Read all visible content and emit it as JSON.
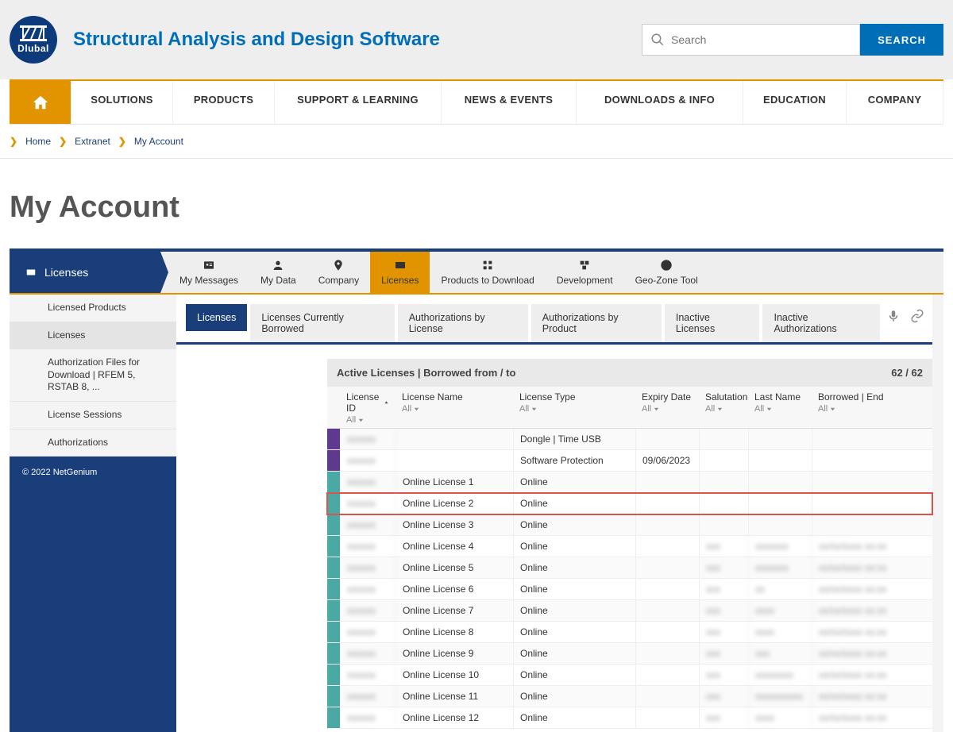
{
  "brand": {
    "logo_text": "Dlubal"
  },
  "site_title": "Structural Analysis and Design Software",
  "search": {
    "placeholder": "Search",
    "button": "SEARCH"
  },
  "main_nav": [
    "SOLUTIONS",
    "PRODUCTS",
    "SUPPORT & LEARNING",
    "NEWS & EVENTS",
    "DOWNLOADS & INFO",
    "EDUCATION",
    "COMPANY"
  ],
  "breadcrumb": [
    "Home",
    "Extranet",
    "My Account"
  ],
  "page_title": "My Account",
  "account_tabs": {
    "current": "Licenses",
    "items": [
      "My Messages",
      "My Data",
      "Company",
      "Licenses",
      "Products to Download",
      "Development",
      "Geo-Zone Tool"
    ],
    "active_index": 3
  },
  "sidenav": {
    "items": [
      "Licensed Products",
      "Licenses",
      "Authorization Files for Download | RFEM 5, RSTAB 8, ...",
      "License Sessions",
      "Authorizations"
    ],
    "active_index": 1
  },
  "sidebar_footer": "© 2022 NetGenium",
  "subtabs": {
    "items": [
      "Licenses",
      "Licenses Currently Borrowed",
      "Authorizations by License",
      "Authorizations by Product",
      "Inactive Licenses",
      "Inactive Authorizations"
    ],
    "active_index": 0
  },
  "table": {
    "title": "Active Licenses | Borrowed from / to",
    "count": "62 / 62",
    "filter_label": "All",
    "columns": [
      "License ID",
      "License Name",
      "License Type",
      "Expiry Date",
      "Salutation",
      "Last Name",
      "Borrowed | End"
    ],
    "rows": [
      {
        "marker": "purple",
        "id": "xxxxxx",
        "name": "",
        "type": "Dongle | Time USB",
        "expiry": "",
        "sal": "",
        "last": "",
        "borrow": ""
      },
      {
        "marker": "purple",
        "id": "xxxxxx",
        "name": "",
        "type": "Software Protection",
        "expiry": "09/06/2023",
        "sal": "",
        "last": "",
        "borrow": ""
      },
      {
        "marker": "teal",
        "id": "xxxxxx",
        "name": "Online License 1",
        "type": "Online",
        "expiry": "",
        "sal": "",
        "last": "",
        "borrow": ""
      },
      {
        "marker": "teal",
        "id": "xxxxxx",
        "name": "Online License 2",
        "type": "Online",
        "expiry": "",
        "sal": "",
        "last": "",
        "borrow": "",
        "highlight": true
      },
      {
        "marker": "teal",
        "id": "xxxxxx",
        "name": "Online License 3",
        "type": "Online",
        "expiry": "",
        "sal": "",
        "last": "",
        "borrow": ""
      },
      {
        "marker": "teal",
        "id": "xxxxxx",
        "name": "Online License 4",
        "type": "Online",
        "expiry": "",
        "sal": "xxx",
        "last": "xxxxxxx",
        "borrow": "xx/xx/xxxx xx:xx"
      },
      {
        "marker": "teal",
        "id": "xxxxxx",
        "name": "Online License 5",
        "type": "Online",
        "expiry": "",
        "sal": "xxx",
        "last": "xxxxxxx",
        "borrow": "xx/xx/xxxx xx:xx"
      },
      {
        "marker": "teal",
        "id": "xxxxxx",
        "name": "Online License 6",
        "type": "Online",
        "expiry": "",
        "sal": "xxx",
        "last": "xx",
        "borrow": "xx/xx/xxxx xx:xx"
      },
      {
        "marker": "teal",
        "id": "xxxxxx",
        "name": "Online License 7",
        "type": "Online",
        "expiry": "",
        "sal": "xxx",
        "last": "xxxx",
        "borrow": "xx/xx/xxxx xx:xx"
      },
      {
        "marker": "teal",
        "id": "xxxxxx",
        "name": "Online License 8",
        "type": "Online",
        "expiry": "",
        "sal": "xxx",
        "last": "xxxx",
        "borrow": "xx/xx/xxxx xx:xx"
      },
      {
        "marker": "teal",
        "id": "xxxxxx",
        "name": "Online License 9",
        "type": "Online",
        "expiry": "",
        "sal": "xxx",
        "last": "xxx",
        "borrow": "xx/xx/xxxx xx:xx"
      },
      {
        "marker": "teal",
        "id": "xxxxxx",
        "name": "Online License 10",
        "type": "Online",
        "expiry": "",
        "sal": "xxx",
        "last": "xxxxxxxx",
        "borrow": "xx/xx/xxxx xx:xx"
      },
      {
        "marker": "teal",
        "id": "xxxxxx",
        "name": "Online License 11",
        "type": "Online",
        "expiry": "",
        "sal": "xxx",
        "last": "xxxxxxxxxx",
        "borrow": "xx/xx/xxxx xx:xx"
      },
      {
        "marker": "teal",
        "id": "xxxxxx",
        "name": "Online License 12",
        "type": "Online",
        "expiry": "",
        "sal": "xxx",
        "last": "xxxx",
        "borrow": "xx/xx/xxxx xx:xx"
      }
    ]
  }
}
